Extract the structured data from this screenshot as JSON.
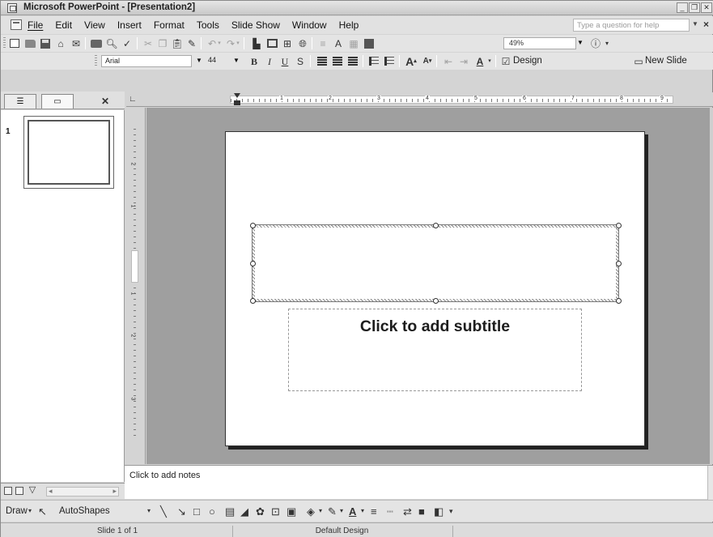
{
  "window": {
    "title": "Microsoft PowerPoint - [Presentation2]"
  },
  "menu": {
    "items": [
      "File",
      "Edit",
      "View",
      "Insert",
      "Format",
      "Tools",
      "Slide Show",
      "Window",
      "Help"
    ],
    "help_placeholder": "Type a question for help"
  },
  "standard_toolbar": {
    "zoom": "49%"
  },
  "formatting_toolbar": {
    "font": "Arial",
    "font_size": "44",
    "bold": "B",
    "italic": "I",
    "underline": "U",
    "shadow": "S",
    "design_label": "Design",
    "new_slide_label": "New Slide"
  },
  "ruler": {
    "h_numbers": [
      "1",
      "2",
      "3",
      "4",
      "5",
      "6",
      "7",
      "8",
      "9"
    ],
    "v_numbers": [
      "2",
      "1",
      "1",
      "2",
      "3"
    ]
  },
  "slides_pane": {
    "slide_number": "1"
  },
  "slide": {
    "subtitle_placeholder": "Click to add subtitle"
  },
  "notes": {
    "placeholder": "Click to add notes"
  },
  "drawing_toolbar": {
    "draw_label": "Draw",
    "autoshapes_label": "AutoShapes"
  },
  "status": {
    "slide_info": "Slide 1 of 1",
    "design": "Default Design"
  }
}
